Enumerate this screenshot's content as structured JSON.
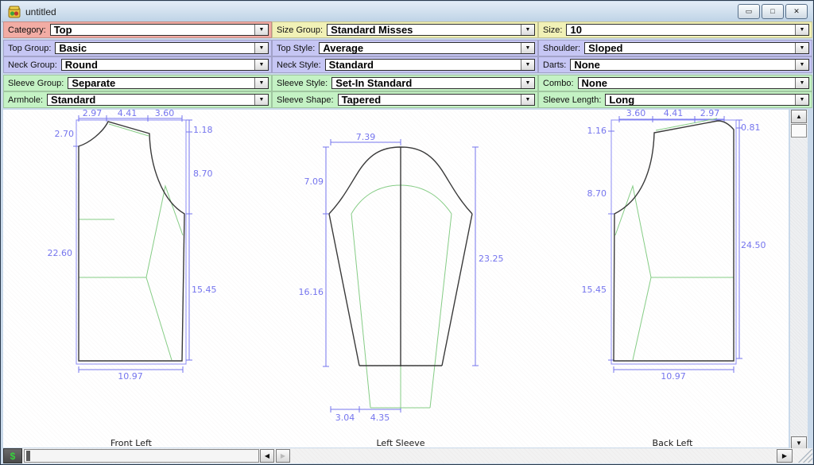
{
  "window": {
    "title": "untitled",
    "icon": "app-icon",
    "buttons": {
      "minimize": "minimize-icon",
      "maximize": "maximize-icon",
      "close": "close-icon"
    }
  },
  "colors": {
    "category_band": "#f2aca4",
    "size_band": "#f1f1b6",
    "style_band": "#c6c6f4",
    "sleeve_band": "#c4f2c4",
    "dimension_text": "#7575ee",
    "outline": "#3a3a3a",
    "construction": "#85cc85"
  },
  "controls": {
    "rows": [
      {
        "fields": [
          {
            "label": "Category:",
            "value": "Top",
            "color": "#f2aca4"
          },
          {
            "label": "Size Group:",
            "value": "Standard Misses",
            "color": "#f1f1b6"
          },
          {
            "label": "Size:",
            "value": "10",
            "color": "#f1f1b6"
          }
        ]
      },
      {
        "fields": [
          {
            "label": "Top Group:",
            "value": "Basic",
            "color": "#c6c6f4"
          },
          {
            "label": "Top Style:",
            "value": "Average",
            "color": "#c6c6f4"
          },
          {
            "label": "Shoulder:",
            "value": "Sloped",
            "color": "#c6c6f4"
          }
        ]
      },
      {
        "fields": [
          {
            "label": "Neck Group:",
            "value": "Round",
            "color": "#c6c6f4"
          },
          {
            "label": "Neck Style:",
            "value": "Standard",
            "color": "#c6c6f4"
          },
          {
            "label": "Darts:",
            "value": "None",
            "color": "#c6c6f4"
          }
        ]
      },
      {
        "fields": [
          {
            "label": "Sleeve Group:",
            "value": "Separate",
            "color": "#c4f2c4"
          },
          {
            "label": "Sleeve Style:",
            "value": "Set-In Standard",
            "color": "#c4f2c4"
          },
          {
            "label": "Combo:",
            "value": "None",
            "color": "#c4f2c4"
          }
        ]
      },
      {
        "fields": [
          {
            "label": "Armhole:",
            "value": "Standard",
            "color": "#c4f2c4"
          },
          {
            "label": "Sleeve Shape:",
            "value": "Tapered",
            "color": "#c4f2c4"
          },
          {
            "label": "Sleeve Length:",
            "value": "Long",
            "color": "#c4f2c4"
          }
        ]
      }
    ],
    "dropdown_arrow": "▼"
  },
  "pieces": [
    {
      "name": "Front Left",
      "dims": {
        "top": [
          "2.97",
          "4.41",
          "3.60"
        ],
        "left": [
          "2.70",
          "22.60"
        ],
        "right": [
          "1.18",
          "8.70",
          "15.45"
        ],
        "bottom": [
          "10.97"
        ]
      }
    },
    {
      "name": "Left Sleeve",
      "dims": {
        "top": [
          "7.39"
        ],
        "left": [
          "7.09",
          "16.16"
        ],
        "right": [
          "23.25"
        ],
        "bottom": [
          "3.04",
          "4.35"
        ]
      }
    },
    {
      "name": "Back Left",
      "dims": {
        "top": [
          "3.60",
          "4.41",
          "2.97"
        ],
        "left": [
          "1.16",
          "8.70",
          "15.45"
        ],
        "right": [
          "0.81",
          "24.50"
        ],
        "bottom": [
          "10.97"
        ]
      }
    }
  ],
  "scrollbars": {
    "dollar_label": "$",
    "up_arrow": "▲",
    "down_arrow": "▼",
    "left_arrow": "◀",
    "right_arrow": "▶"
  },
  "winbtn_glyphs": {
    "minimize": "▭",
    "maximize": "□",
    "close": "✕"
  }
}
